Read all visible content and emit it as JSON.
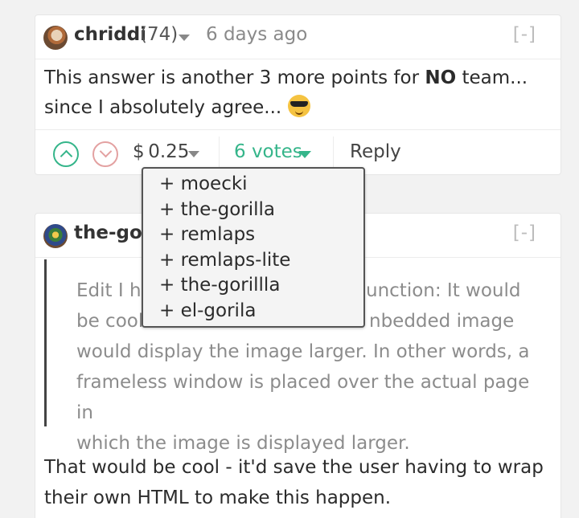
{
  "comment1": {
    "username": "chriddi",
    "points": "(74)",
    "timestamp": "6 days ago",
    "collapse_label": "[-]",
    "text_before": "This answer is another 3 more points for ",
    "text_bold": "NO",
    "text_after": " team... since I absolutely agree... ",
    "emoji_icon": "smiling-face-with-sunglasses-icon",
    "amount": "$ 0.25",
    "votes_label": "6 votes",
    "reply_label": "Reply"
  },
  "voters_dropdown": {
    "items": [
      "+ moecki",
      "+ the-gorilla",
      "+ remlaps",
      "+ remlaps-lite",
      "+ the-gorillla",
      "+ el-gorila"
    ]
  },
  "comment2": {
    "username": "the-gor",
    "collapse_label": "[-]",
    "quote_lines": [
      "Edit I ha",
      "unction: It would",
      "be cool",
      "nbedded image",
      "would display the image larger. In other words, a",
      "frameless window is placed over the actual page in",
      "which the image is displayed larger."
    ],
    "body": "That would be cool - it'd save the user having to wrap their own HTML to make this happen."
  },
  "colors": {
    "upvote": "#35b58a",
    "downvote": "#e3a1a1",
    "votes": "#35b58a"
  }
}
